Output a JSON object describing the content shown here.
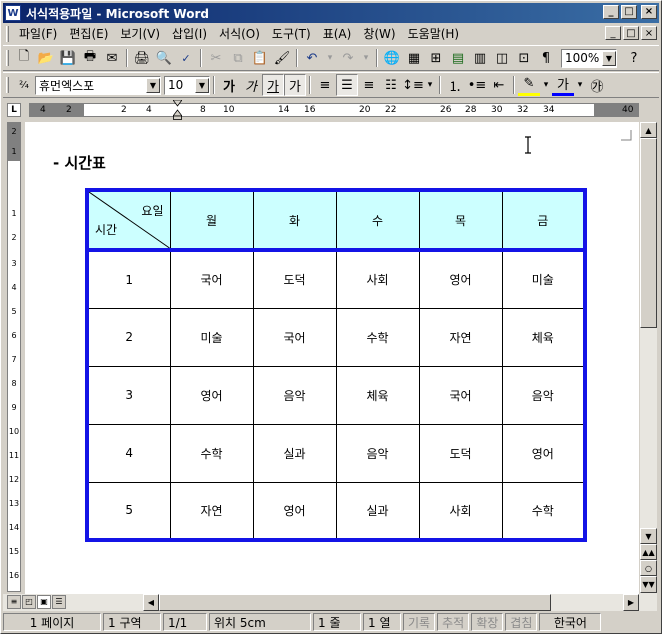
{
  "window": {
    "title": "서식적용파일 - Microsoft Word",
    "app_icon": "W"
  },
  "menu": [
    "파일(F)",
    "편집(E)",
    "보기(V)",
    "삽입(I)",
    "서식(O)",
    "도구(T)",
    "표(A)",
    "창(W)",
    "도움말(H)"
  ],
  "toolbar": {
    "zoom": "100%",
    "font": "휴먼엑스포",
    "font_size": "10",
    "bold_label": "가",
    "italic_label": "가",
    "underline_label": "가",
    "shadow_label": "가",
    "font_color_label": "가"
  },
  "ruler": {
    "numbers": [
      "4",
      "2",
      "2",
      "4",
      "8",
      "10",
      "14",
      "16",
      "20",
      "22",
      "26",
      "28",
      "30",
      "32",
      "34",
      "40"
    ],
    "vnumbers": [
      "2",
      "1",
      "1",
      "2",
      "3",
      "4",
      "5",
      "6",
      "7",
      "8",
      "9",
      "10",
      "11",
      "12",
      "13",
      "14",
      "15",
      "16"
    ]
  },
  "document": {
    "heading": "- 시간표",
    "corner_day": "요일",
    "corner_time": "시간",
    "days": [
      "월",
      "화",
      "수",
      "목",
      "금"
    ],
    "rows": [
      {
        "period": "1",
        "subjects": [
          "국어",
          "도덕",
          "사회",
          "영어",
          "미술"
        ]
      },
      {
        "period": "2",
        "subjects": [
          "미술",
          "국어",
          "수학",
          "자연",
          "체육"
        ]
      },
      {
        "period": "3",
        "subjects": [
          "영어",
          "음악",
          "체육",
          "국어",
          "음악"
        ]
      },
      {
        "period": "4",
        "subjects": [
          "수학",
          "실과",
          "음악",
          "도덕",
          "영어"
        ]
      },
      {
        "period": "5",
        "subjects": [
          "자연",
          "영어",
          "실과",
          "사회",
          "수학"
        ]
      }
    ]
  },
  "status": {
    "page": "1 페이지",
    "section": "1 구역",
    "pages": "1/1",
    "position": "위치 5cm",
    "line": "1 줄",
    "column": "1 열",
    "rec": "기록",
    "trk": "추적",
    "ext": "확장",
    "ovr": "겹침",
    "lang": "한국어"
  }
}
